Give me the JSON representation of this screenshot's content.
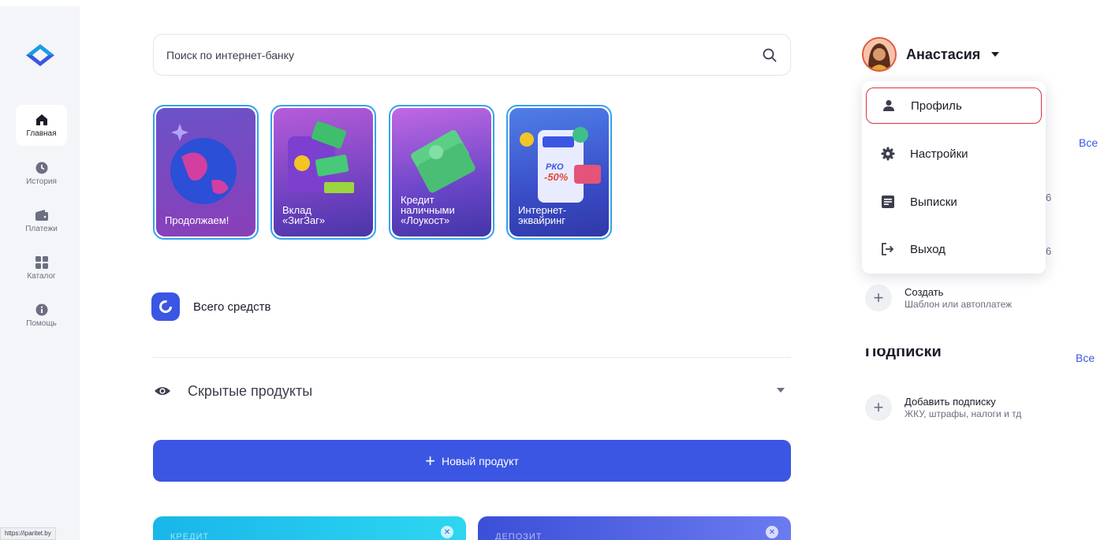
{
  "sidebar": {
    "items": [
      {
        "label": "Главная",
        "icon": "home-icon",
        "active": true
      },
      {
        "label": "История",
        "icon": "clock-icon"
      },
      {
        "label": "Платежи",
        "icon": "wallet-icon"
      },
      {
        "label": "Каталог",
        "icon": "grid-icon"
      },
      {
        "label": "Помощь",
        "icon": "info-icon"
      }
    ]
  },
  "search": {
    "placeholder": "Поиск по интернет-банку",
    "icon": "search-icon"
  },
  "stories": [
    {
      "title": "Продолжаем!"
    },
    {
      "title": "Вклад\n«ЗигЗаг»"
    },
    {
      "title": "Кредит\nналичными\n«Лоукост»"
    },
    {
      "title": "Интернет-\nэквайринг"
    }
  ],
  "total": {
    "label": "Всего средств"
  },
  "hidden_products": {
    "label": "Скрытые продукты"
  },
  "new_product": {
    "label": "Новый продукт"
  },
  "cards": [
    {
      "label": "КРЕДИТ"
    },
    {
      "label": "ДЕПОЗИТ"
    }
  ],
  "user": {
    "name": "Анастасия"
  },
  "menu": {
    "items": [
      {
        "label": "Профиль",
        "icon": "person-icon",
        "highlighted": true
      },
      {
        "label": "Настройки",
        "icon": "gear-icon"
      },
      {
        "label": "Выписки",
        "icon": "document-icon"
      },
      {
        "label": "Выход",
        "icon": "logout-icon"
      }
    ]
  },
  "right": {
    "all_link": "Все",
    "partial_values": [
      "6",
      "6"
    ],
    "create": {
      "title": "Создать",
      "subtitle": "Шаблон или автоплатеж"
    },
    "subscriptions": {
      "title": "Подписки",
      "all_link": "Все"
    },
    "add_subscription": {
      "title": "Добавить подписку",
      "subtitle": "ЖКУ, штрафы, налоги и тд"
    }
  },
  "status_url": "https://iparitet.by",
  "colors": {
    "accent": "#3b56e3",
    "story_border": "#34a3ec",
    "highlight": "#d8343d"
  }
}
